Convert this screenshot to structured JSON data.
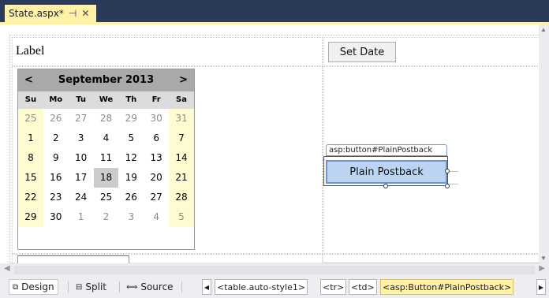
{
  "tab": {
    "title": "State.aspx*",
    "pin_glyph": "⊣",
    "close_glyph": "✕"
  },
  "form": {
    "label_text": "Label",
    "set_date_button": "Set Date",
    "plain_postback_tag": "asp:button#PlainPostback",
    "plain_postback_button": "Plain Postback",
    "textbox_value": ""
  },
  "calendar": {
    "prev": "<",
    "title": "September 2013",
    "next": ">",
    "days_of_week": [
      "Su",
      "Mo",
      "Tu",
      "We",
      "Th",
      "Fr",
      "Sa"
    ],
    "weeks": [
      [
        "25",
        "26",
        "27",
        "28",
        "29",
        "30",
        "31"
      ],
      [
        "1",
        "2",
        "3",
        "4",
        "5",
        "6",
        "7"
      ],
      [
        "8",
        "9",
        "10",
        "11",
        "12",
        "13",
        "14"
      ],
      [
        "15",
        "16",
        "17",
        "18",
        "19",
        "20",
        "21"
      ],
      [
        "22",
        "23",
        "24",
        "25",
        "26",
        "27",
        "28"
      ],
      [
        "29",
        "30",
        "1",
        "2",
        "3",
        "4",
        "5"
      ]
    ],
    "other_month_cells": [
      [
        0,
        0
      ],
      [
        0,
        1
      ],
      [
        0,
        2
      ],
      [
        0,
        3
      ],
      [
        0,
        4
      ],
      [
        0,
        5
      ],
      [
        0,
        6
      ],
      [
        5,
        2
      ],
      [
        5,
        3
      ],
      [
        5,
        4
      ],
      [
        5,
        5
      ],
      [
        5,
        6
      ]
    ],
    "selected_day": "18"
  },
  "bottom": {
    "modes": [
      {
        "icon": "⧉",
        "label": "Design",
        "icon_name": "design-view-icon"
      },
      {
        "icon": "⊟",
        "label": "Split",
        "icon_name": "split-view-icon"
      },
      {
        "icon": "⟺",
        "label": "Source",
        "icon_name": "source-view-icon"
      }
    ],
    "nav_left": "◀",
    "nav_right": "▶",
    "breadcrumbs": [
      "<table.auto-style1>",
      "<tr>",
      "<td>",
      "<asp:Button#PlainPostback>"
    ]
  },
  "colors": {
    "tab_active": "#fff1a8",
    "tabbar": "#2b3a59",
    "weekend": "#fffbd0",
    "selected_control": "#bcd3f1"
  }
}
